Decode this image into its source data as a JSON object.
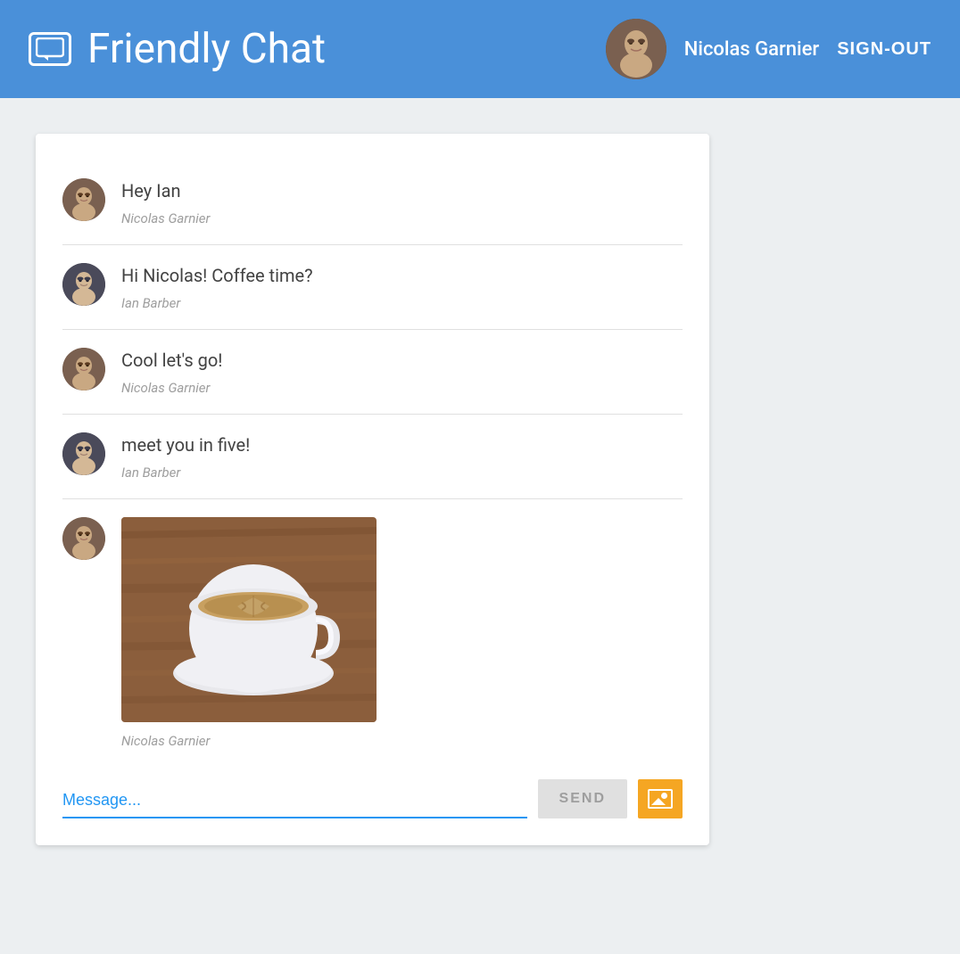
{
  "header": {
    "title": "Friendly Chat",
    "logo_alt": "chat-logo",
    "username": "Nicolas Garnier",
    "signout_label": "SIGN-OUT"
  },
  "messages": [
    {
      "id": 1,
      "text": "Hey Ian",
      "author": "Nicolas Garnier",
      "avatar_type": "nicolas"
    },
    {
      "id": 2,
      "text": "Hi Nicolas! Coffee time?",
      "author": "Ian Barber",
      "avatar_type": "ian"
    },
    {
      "id": 3,
      "text": "Cool let's go!",
      "author": "Nicolas Garnier",
      "avatar_type": "nicolas"
    },
    {
      "id": 4,
      "text": "meet you in five!",
      "author": "Ian Barber",
      "avatar_type": "ian"
    }
  ],
  "image_message": {
    "author": "Nicolas Garnier",
    "avatar_type": "nicolas",
    "image_alt": "coffee cup"
  },
  "input": {
    "placeholder": "Message...",
    "send_label": "SEND",
    "image_upload_alt": "upload image"
  }
}
